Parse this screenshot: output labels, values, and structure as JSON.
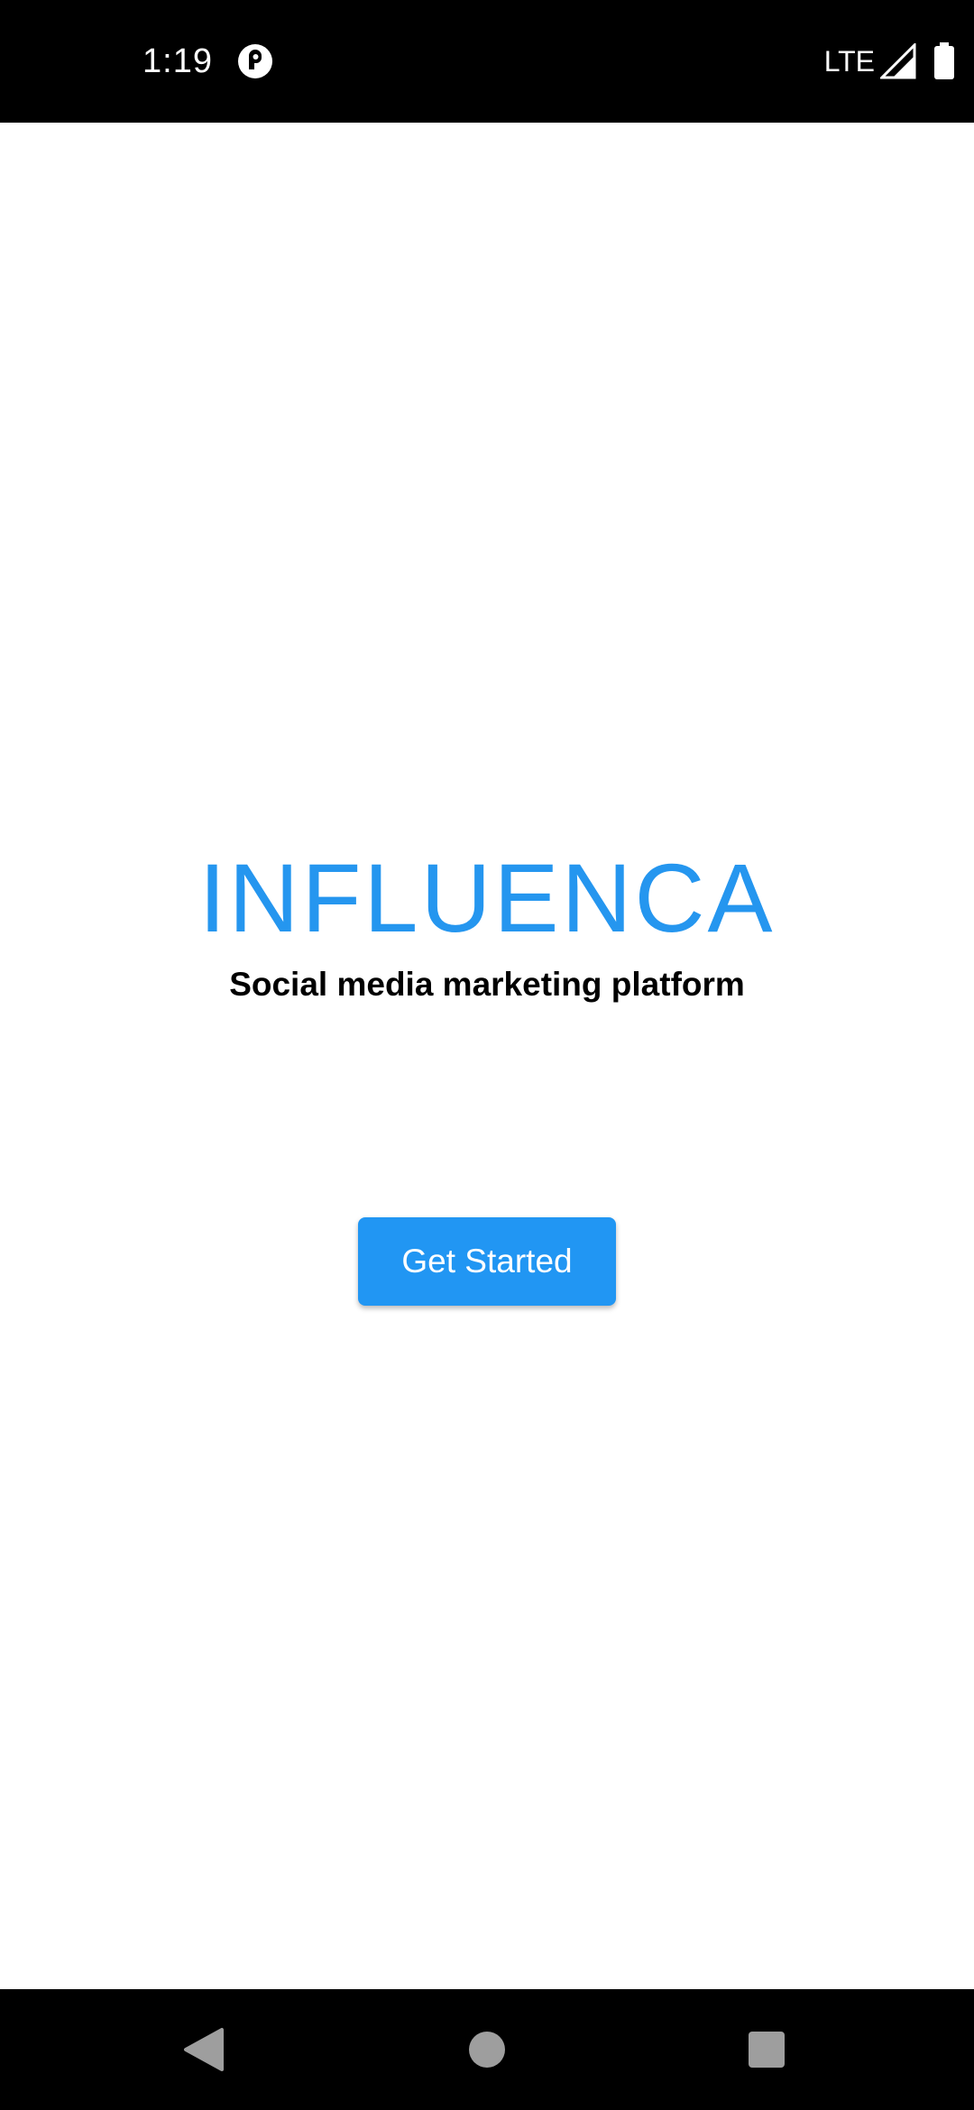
{
  "status_bar": {
    "time": "1:19",
    "network": "LTE",
    "icons": [
      "app-notification-icon",
      "signal-icon",
      "battery-icon"
    ]
  },
  "splash": {
    "title": "INFLUENCA",
    "tagline": "Social media marketing platform",
    "cta_label": "Get Started"
  },
  "nav_bar": {
    "icons": [
      "back-icon",
      "home-icon",
      "recents-icon"
    ]
  },
  "colors": {
    "brand": "#2596ef",
    "button": "#2196f3",
    "system_bars": "#000000"
  }
}
